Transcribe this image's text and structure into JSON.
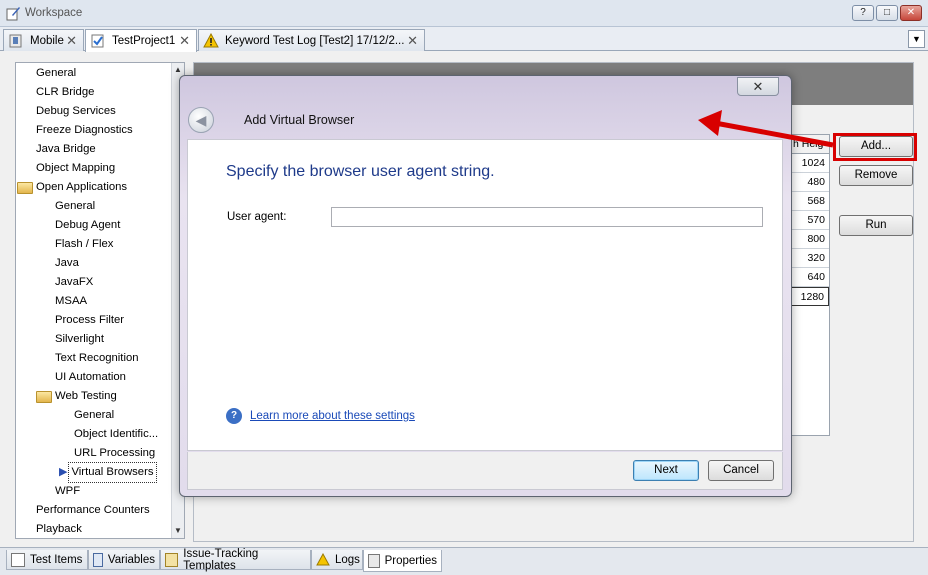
{
  "window": {
    "title": "Workspace",
    "controls": [
      "?",
      "□",
      "✕"
    ]
  },
  "tabs": [
    {
      "label": "Mobile"
    },
    {
      "label": "TestProject1"
    },
    {
      "label": "Keyword Test Log [Test2] 17/12/2..."
    }
  ],
  "tree": {
    "items": [
      {
        "label": "General",
        "level": 0
      },
      {
        "label": "CLR Bridge",
        "level": 0
      },
      {
        "label": "Debug Services",
        "level": 0
      },
      {
        "label": "Freeze Diagnostics",
        "level": 0
      },
      {
        "label": "Java Bridge",
        "level": 0
      },
      {
        "label": "Object Mapping",
        "level": 0
      },
      {
        "label": "Open Applications",
        "level": 0,
        "folder": true
      },
      {
        "label": "General",
        "level": 1
      },
      {
        "label": "Debug Agent",
        "level": 1
      },
      {
        "label": "Flash / Flex",
        "level": 1
      },
      {
        "label": "Java",
        "level": 1
      },
      {
        "label": "JavaFX",
        "level": 1
      },
      {
        "label": "MSAA",
        "level": 1
      },
      {
        "label": "Process Filter",
        "level": 1
      },
      {
        "label": "Silverlight",
        "level": 1
      },
      {
        "label": "Text Recognition",
        "level": 1
      },
      {
        "label": "UI Automation",
        "level": 1
      },
      {
        "label": "Web Testing",
        "level": 1,
        "folder": true
      },
      {
        "label": "General",
        "level": 2
      },
      {
        "label": "Object Identific...",
        "level": 2
      },
      {
        "label": "URL Processing",
        "level": 2
      },
      {
        "label": "Virtual Browsers",
        "level": 2,
        "selected": true
      },
      {
        "label": "WPF",
        "level": 1
      },
      {
        "label": "Performance Counters",
        "level": 0
      },
      {
        "label": "Playback",
        "level": 0
      }
    ]
  },
  "grid": {
    "header": "h Heig",
    "values": [
      "1024",
      "480",
      "568",
      "570",
      "800",
      "320",
      "640",
      "1280"
    ]
  },
  "right_buttons": {
    "add": "Add...",
    "remove": "Remove",
    "run": "Run"
  },
  "dialog": {
    "title": "Add Virtual Browser",
    "heading": "Specify the browser user agent string.",
    "user_agent_label": "User agent:",
    "user_agent_value": "",
    "help_link": "Learn more about these settings",
    "next": "Next",
    "cancel": "Cancel",
    "close": "✕"
  },
  "bottom_tabs": [
    {
      "label": "Test Items"
    },
    {
      "label": "Variables"
    },
    {
      "label": "Issue-Tracking Templates"
    },
    {
      "label": "Logs"
    },
    {
      "label": "Properties"
    }
  ],
  "colors": {
    "highlight": "#d80000",
    "link": "#1a4ab8",
    "heading": "#1e3a8a"
  }
}
